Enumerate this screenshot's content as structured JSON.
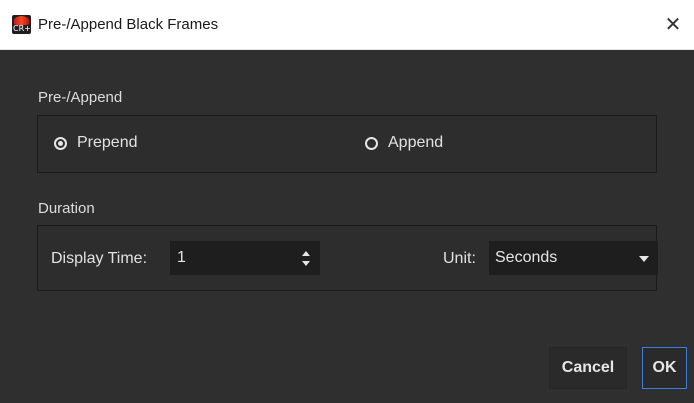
{
  "window": {
    "title": "Pre-/Append Black Frames",
    "icon_text": "CR+",
    "close_glyph": "✕"
  },
  "pre_append": {
    "label": "Pre-/Append",
    "options": [
      {
        "label": "Prepend",
        "checked": true
      },
      {
        "label": "Append",
        "checked": false
      }
    ]
  },
  "duration": {
    "label": "Duration",
    "display_time_label": "Display Time:",
    "display_time_value": "1",
    "unit_label": "Unit:",
    "unit_value": "Seconds"
  },
  "buttons": {
    "cancel": "Cancel",
    "ok": "OK"
  },
  "colors": {
    "dialog_bg": "#2f2f2f",
    "ok_border": "#3d7fd6"
  }
}
